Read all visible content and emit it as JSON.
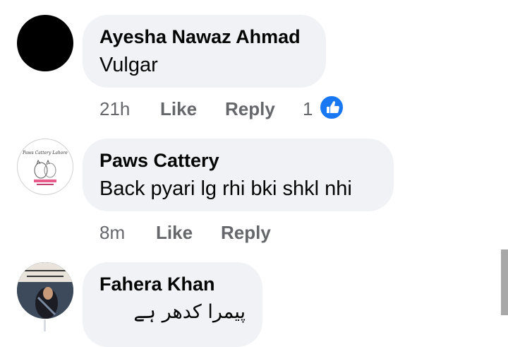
{
  "comments": [
    {
      "author": "Ayesha Nawaz Ahmad",
      "text": "Vulgar",
      "time": "21h",
      "like_label": "Like",
      "reply_label": "Reply",
      "reaction_count": "1",
      "avatar_icon": "black-circle-avatar"
    },
    {
      "author": "Paws Cattery",
      "text": "Back pyari lg rhi bki shkl nhi",
      "time": "8m",
      "like_label": "Like",
      "reply_label": "Reply",
      "avatar_icon": "cat-logo-avatar",
      "avatar_text": "Paws Cattery Lahore"
    },
    {
      "author": "Fahera Khan",
      "text": "پیمرا کدھر ہے",
      "avatar_icon": "photo-avatar"
    }
  ],
  "colors": {
    "bubble": "#f0f2f5",
    "meta": "#65676b",
    "like_blue": "#1877f2"
  }
}
